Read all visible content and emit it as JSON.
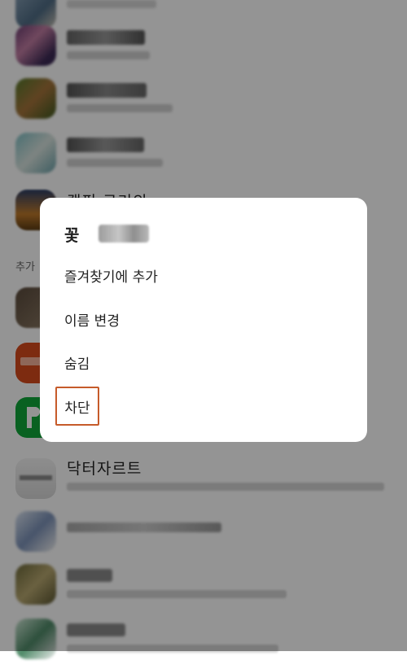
{
  "dialog": {
    "title": "꽃",
    "menu": [
      {
        "label": "즐겨찾기에 추가"
      },
      {
        "label": "이름 변경"
      },
      {
        "label": "숨김"
      },
      {
        "label": "차단"
      }
    ],
    "highlight_color": "#c65b2a"
  },
  "background": {
    "visible_names": [
      "캠핑 구리의",
      "닥터자르트"
    ],
    "section_label": "추가",
    "overlay_color": "rgba(0,0,0,0.42)"
  }
}
